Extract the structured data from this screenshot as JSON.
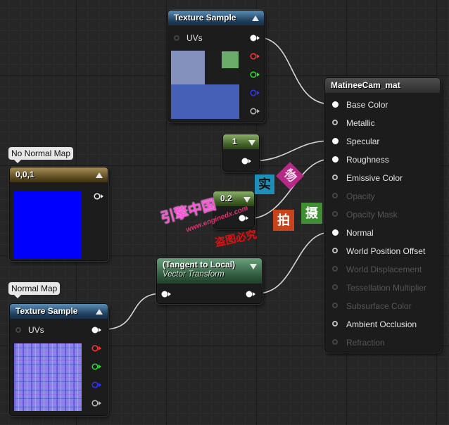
{
  "colors": {
    "wire": "#d8d8d8",
    "pin_red": "#ff3333",
    "pin_green": "#33dd33",
    "pin_blue": "#3333ff"
  },
  "texture_top": {
    "title": "Texture Sample",
    "uv_label": "UVs",
    "icon": "collapse-arrow-icon"
  },
  "note_no_normal": {
    "text": "No Normal Map"
  },
  "const_vec": {
    "title": "0,0,1",
    "swatch_color": "#0000ff"
  },
  "note_normal": {
    "text": "Normal Map"
  },
  "texture_bottom": {
    "title": "Texture Sample",
    "uv_label": "UVs"
  },
  "const_one": {
    "title": "1"
  },
  "const_point2": {
    "title": "0.2"
  },
  "transform": {
    "title": "(Tangent to Local)",
    "subtitle": "Vector Transform"
  },
  "material": {
    "title": "MatineeCam_mat",
    "inputs": [
      {
        "label": "Base Color",
        "state": "connected"
      },
      {
        "label": "Metallic",
        "state": "enabled"
      },
      {
        "label": "Specular",
        "state": "connected"
      },
      {
        "label": "Roughness",
        "state": "connected"
      },
      {
        "label": "Emissive Color",
        "state": "enabled"
      },
      {
        "label": "Opacity",
        "state": "disabled"
      },
      {
        "label": "Opacity Mask",
        "state": "disabled"
      },
      {
        "label": "Normal",
        "state": "connected"
      },
      {
        "label": "World Position Offset",
        "state": "enabled"
      },
      {
        "label": "World Displacement",
        "state": "disabled"
      },
      {
        "label": "Tessellation Multiplier",
        "state": "disabled"
      },
      {
        "label": "Subsurface Color",
        "state": "disabled"
      },
      {
        "label": "Ambient Occlusion",
        "state": "enabled"
      },
      {
        "label": "Refraction",
        "state": "disabled"
      }
    ]
  },
  "watermark": {
    "cn1": "实",
    "cn2": "物",
    "cn3": "拍",
    "cn4": "摄",
    "brand": "引擎中国",
    "url": "www.enginedx.com",
    "notice": "盗图必究"
  }
}
